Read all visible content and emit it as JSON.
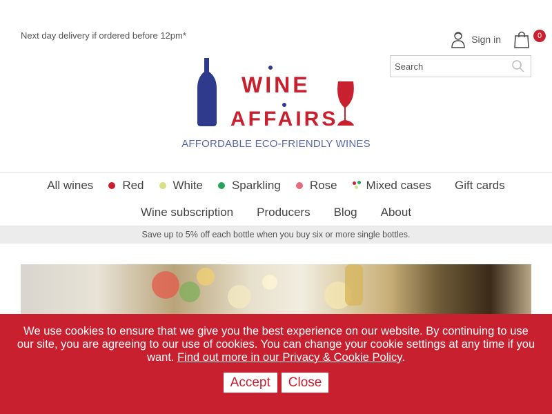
{
  "header": {
    "delivery_note": "Next day delivery if ordered before 12pm*",
    "sign_in_label": "Sign in",
    "cart_count": "0",
    "search_placeholder": "Search"
  },
  "brand": {
    "logo_word_1": "WINE",
    "logo_word_2": "AFFAIRS",
    "tagline": "AFFORDABLE ECO-FRIENDLY WINES",
    "red": "#c8202f",
    "navy": "#2f3a8c",
    "tagline_color": "#5a67a6"
  },
  "nav": {
    "row1": [
      {
        "label": "All wines",
        "marker": "none"
      },
      {
        "label": "Red",
        "marker": "dot",
        "color": "#c8202f"
      },
      {
        "label": "White",
        "marker": "dot",
        "color": "#d8df86"
      },
      {
        "label": "Sparkling",
        "marker": "dot",
        "color": "#2aa35a"
      },
      {
        "label": "Rose",
        "marker": "dot",
        "color": "#e56a7c"
      },
      {
        "label": "Mixed cases",
        "marker": "multi-dot"
      },
      {
        "label": "Gift cards",
        "marker": "none"
      }
    ],
    "row2": [
      {
        "label": "Wine subscription"
      },
      {
        "label": "Producers"
      },
      {
        "label": "Blog"
      },
      {
        "label": "About"
      }
    ]
  },
  "promo_banner": "Save up to 5% off each bottle when you buy six or more single bottles.",
  "cookie_banner": {
    "text": "We use cookies to ensure that we give you the best experience on our website. By continuing to use our site, you are agreeing to our use of cookies. You can change your cookie settings at any time if you want.",
    "link_text": "Find out more in our Privacy & Cookie Policy",
    "trailing": ".",
    "accept_label": "Accept",
    "close_label": "Close"
  },
  "icons": {
    "sign_in": "person-icon",
    "cart": "shopping-bag-icon",
    "search": "magnifier-icon"
  }
}
